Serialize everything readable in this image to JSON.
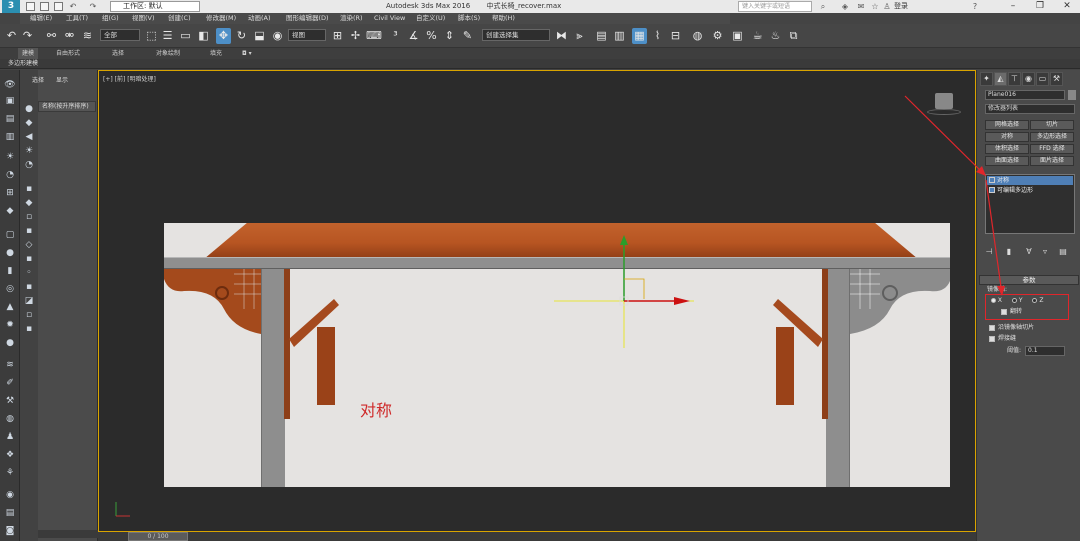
{
  "titlebar": {
    "workspace": "工作区: 默认",
    "app_title": "Autodesk 3ds Max 2016",
    "file_name": "中式长椅_recover.max",
    "search_placeholder": "键入关键字或短语",
    "login": "登录",
    "help": "?"
  },
  "menubar": {
    "items": [
      "编辑(E)",
      "工具(T)",
      "组(G)",
      "视图(V)",
      "创建(C)",
      "修改器(M)",
      "动画(A)",
      "图形编辑器(D)",
      "渲染(R)",
      "Civil View",
      "自定义(U)",
      "脚本(S)",
      "帮助(H)"
    ]
  },
  "toolbar": {
    "selection_filter": "全部",
    "ref_coord": "视图",
    "named_selection": "创建选择集"
  },
  "ribbon": {
    "tabs": [
      "建模",
      "自由形式",
      "选择",
      "对象绘制",
      "填充"
    ],
    "active_tab": "建模",
    "sub_label": "多边形建模"
  },
  "explorer": {
    "tabs": [
      "选择",
      "显示"
    ],
    "column_header": "名称(按升序排序)"
  },
  "viewport": {
    "label": "[+] [前] [明暗处理]",
    "overlay_text": "对称"
  },
  "timeline": {
    "frame": "0 / 100"
  },
  "command_panel": {
    "object_name": "Plane016",
    "modifier_list": "修改器列表",
    "buttons": [
      [
        "网格选择",
        "切片"
      ],
      [
        "对称",
        "多边形选择"
      ],
      [
        "体积选择",
        "FFD 选择"
      ],
      [
        "曲面选择",
        "面片选择"
      ]
    ],
    "stack": [
      {
        "label": "对称",
        "selected": true
      },
      {
        "label": "可编辑多边形",
        "selected": false
      }
    ],
    "params_title": "参数",
    "mirror_axis_label": "镜像轴:",
    "axes": [
      {
        "label": "X",
        "checked": true
      },
      {
        "label": "Y",
        "checked": false
      },
      {
        "label": "Z",
        "checked": false
      }
    ],
    "flip_label": "翻转",
    "flip_checked": true,
    "slice_label": "沿镜像轴切片",
    "slice_checked": true,
    "weld_label": "焊接缝",
    "weld_checked": true,
    "threshold_label": "阈值:",
    "threshold_value": "0.1"
  },
  "colors": {
    "accent_blue": "#4d8fc7",
    "annotation_red": "#e0262b",
    "viewport_border": "#d9a400"
  }
}
